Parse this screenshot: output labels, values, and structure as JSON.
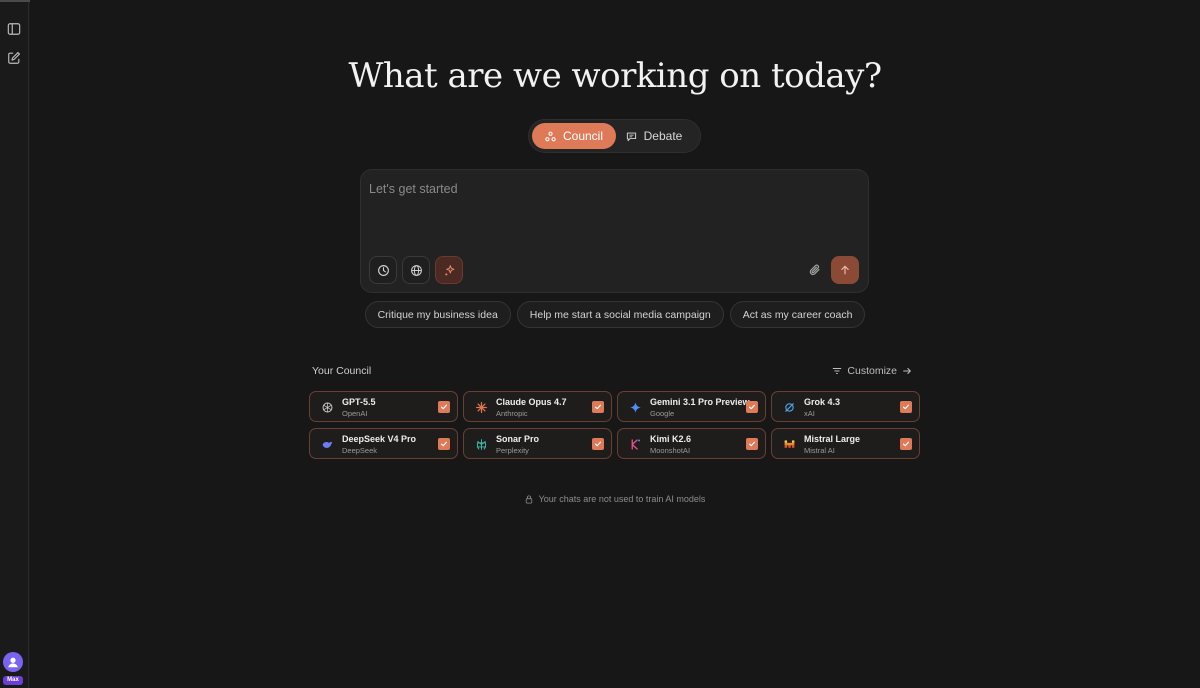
{
  "sidebar": {
    "toggle_icon": "sidebar-panel-icon",
    "new_chat_icon": "edit-icon",
    "user_icon": "user-icon",
    "user_badge": "Max"
  },
  "headline": "What are we working on today?",
  "modes": [
    {
      "label": "Council",
      "icon": "people-icon",
      "active": true
    },
    {
      "label": "Debate",
      "icon": "chat-icon",
      "active": false
    }
  ],
  "composer": {
    "placeholder": "Let's get started",
    "value": "",
    "tools": [
      "clock-icon",
      "globe-icon",
      "sparkle-icon"
    ],
    "attach_icon": "paperclip-icon",
    "send_icon": "arrow-up-icon"
  },
  "suggestions": [
    "Critique my business idea",
    "Help me start a social media campaign",
    "Act as my career coach"
  ],
  "council": {
    "title": "Your Council",
    "customize_label": "Customize",
    "models": [
      {
        "name": "GPT-5.5",
        "vendor": "OpenAI",
        "icon": "openai-icon",
        "checked": true
      },
      {
        "name": "Claude Opus 4.7",
        "vendor": "Anthropic",
        "icon": "anthropic-icon",
        "checked": true
      },
      {
        "name": "Gemini 3.1 Pro Preview",
        "vendor": "Google",
        "icon": "gemini-icon",
        "checked": true
      },
      {
        "name": "Grok 4.3",
        "vendor": "xAI",
        "icon": "grok-icon",
        "checked": true
      },
      {
        "name": "DeepSeek V4 Pro",
        "vendor": "DeepSeek",
        "icon": "deepseek-icon",
        "checked": true
      },
      {
        "name": "Sonar Pro",
        "vendor": "Perplexity",
        "icon": "perplexity-icon",
        "checked": true
      },
      {
        "name": "Kimi K2.6",
        "vendor": "MoonshotAI",
        "icon": "kimi-icon",
        "checked": true
      },
      {
        "name": "Mistral Large",
        "vendor": "Mistral AI",
        "icon": "mistral-icon",
        "checked": true
      }
    ]
  },
  "privacy_note": "Your chats are not used to train AI models",
  "colors": {
    "accent": "#df7a58",
    "background": "#171717",
    "card_border": "#6a3f33"
  }
}
